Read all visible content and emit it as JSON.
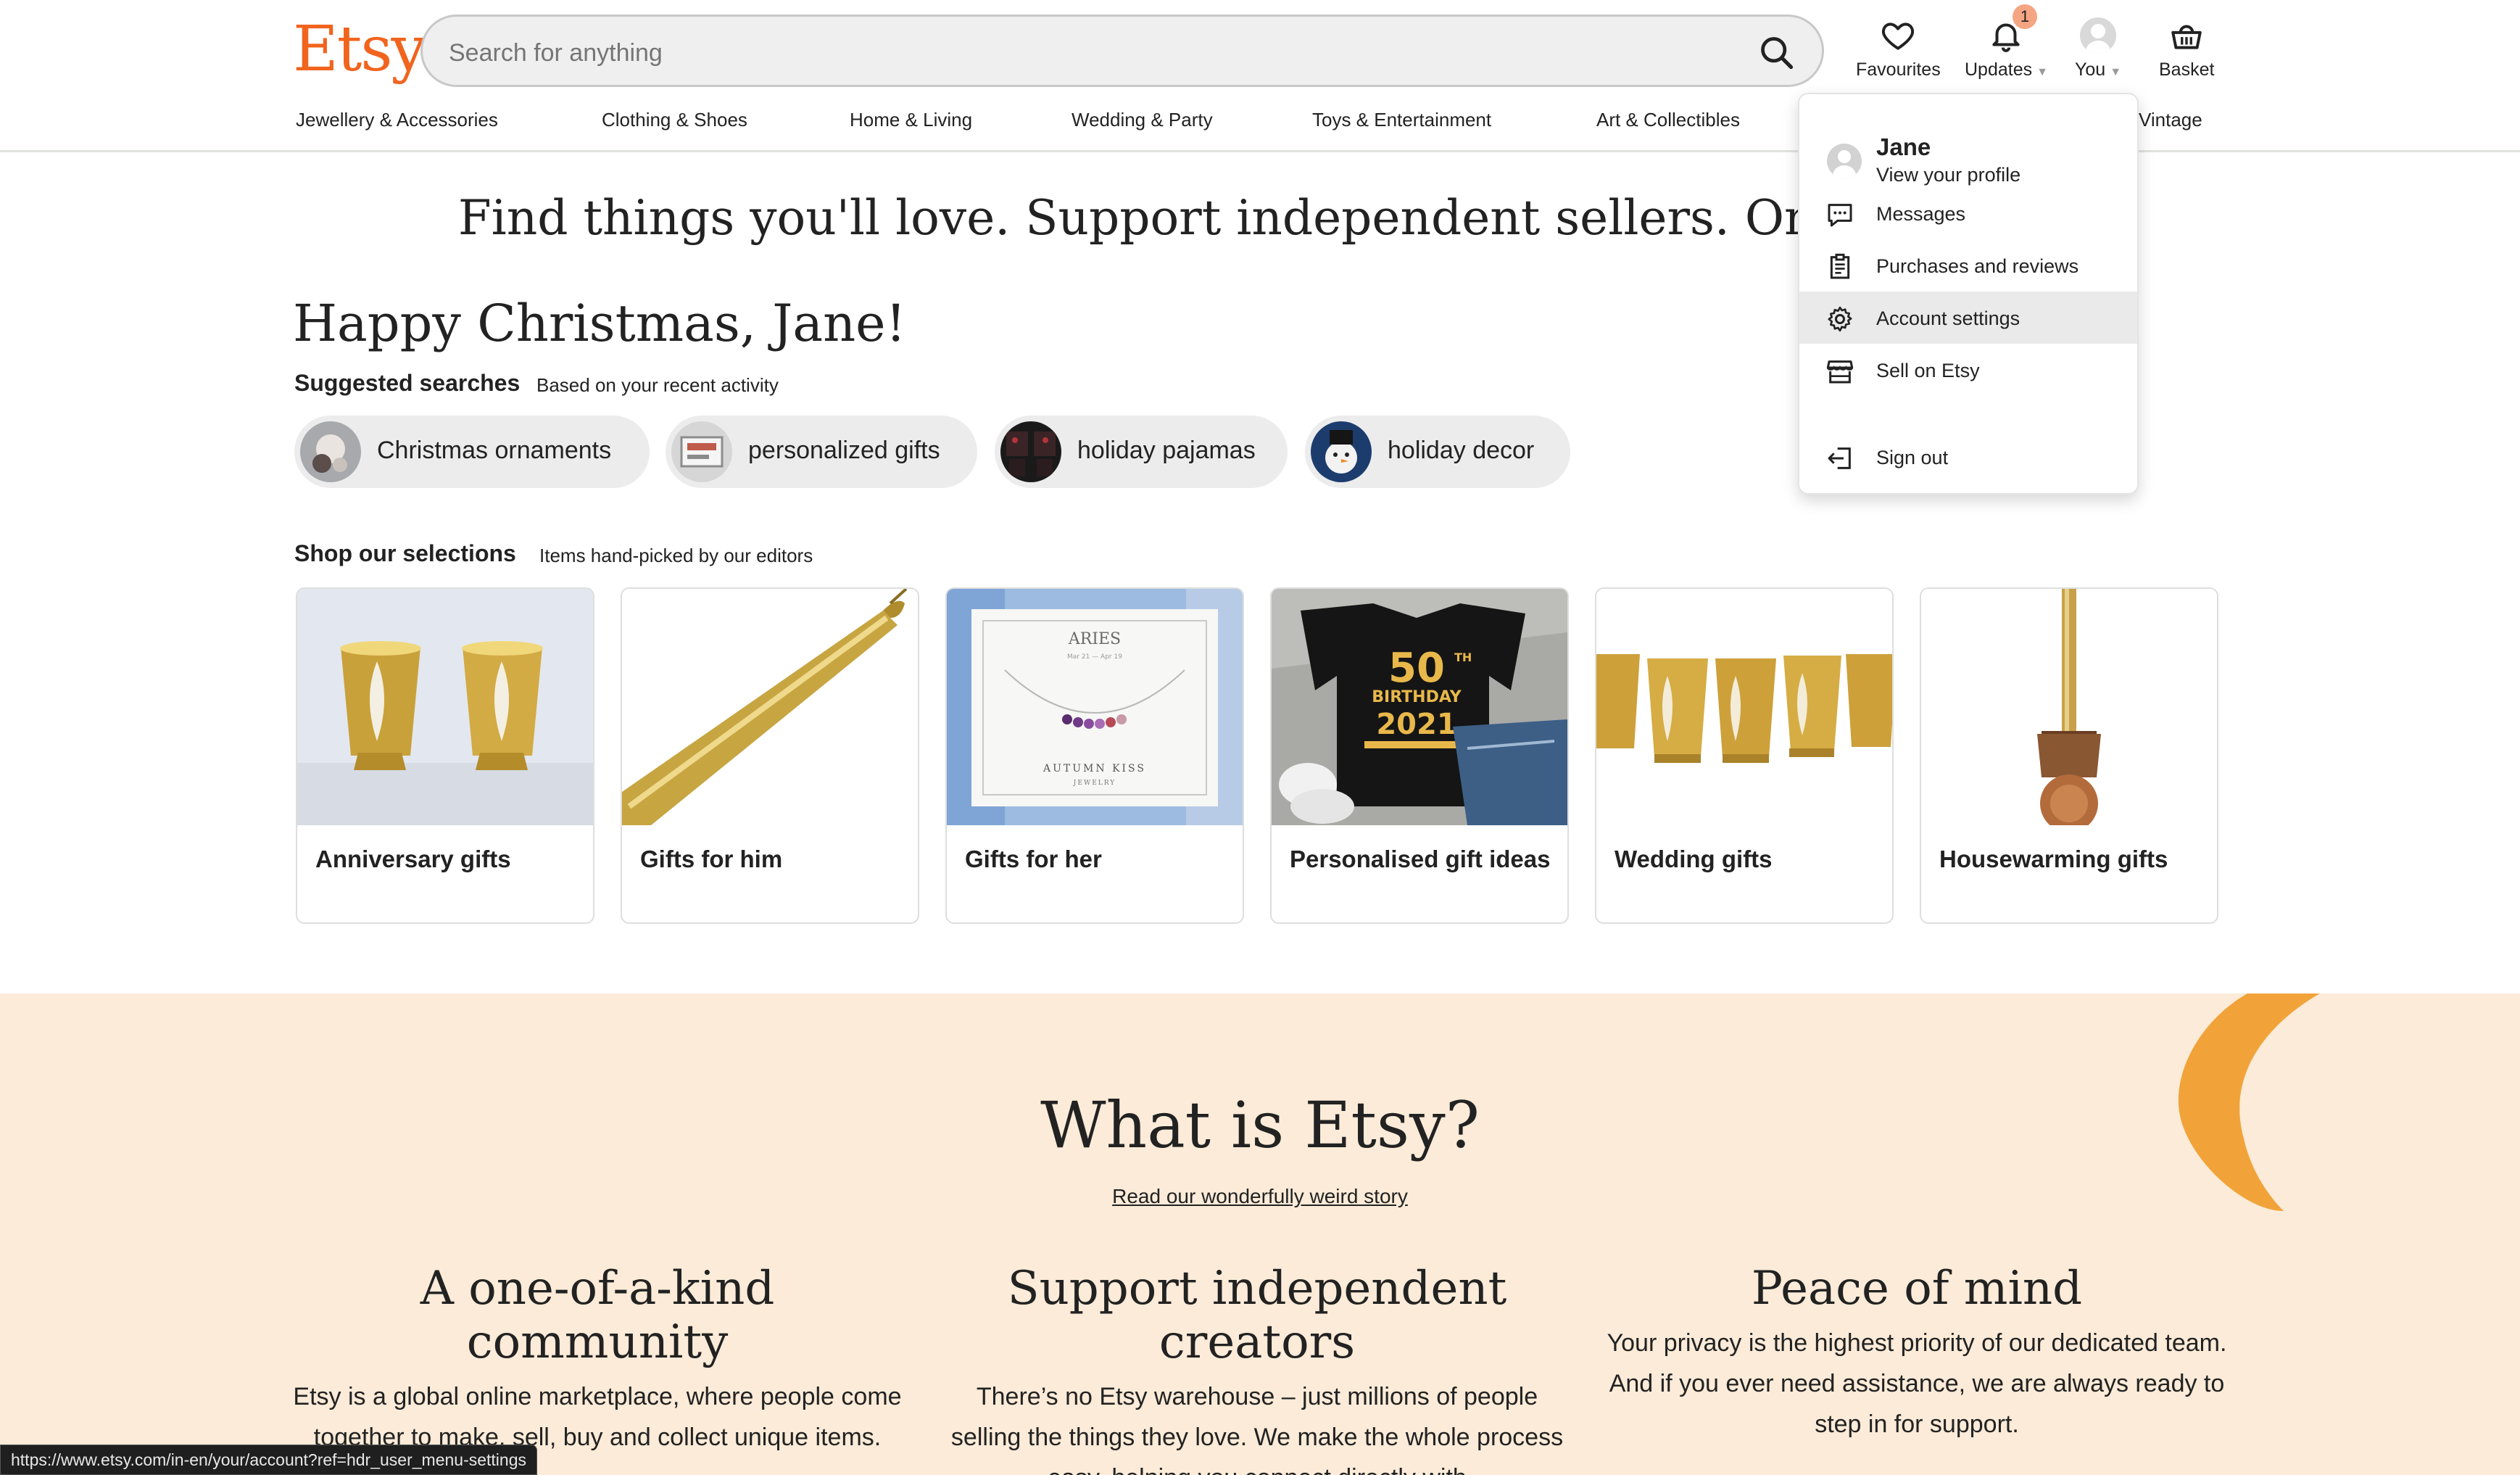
{
  "header": {
    "logo": "Etsy",
    "search_placeholder": "Search for anything",
    "actions": {
      "favourites": "Favourites",
      "updates": "Updates",
      "updates_badge": "1",
      "you": "You",
      "basket": "Basket"
    },
    "categories": [
      "Jewellery & Accessories",
      "Clothing & Shoes",
      "Home & Living",
      "Wedding & Party",
      "Toys & Entertainment",
      "Art & Collectibles",
      "Vintage"
    ]
  },
  "main": {
    "tagline": "Find things you'll love. Support independent sellers. Only on Etsy.",
    "greeting": "Happy Christmas, Jane!",
    "suggested": {
      "title": "Suggested searches",
      "subtitle": "Based on your recent activity",
      "items": [
        "Christmas ornaments",
        "personalized gifts",
        "holiday pajamas",
        "holiday decor"
      ]
    },
    "selections": {
      "title": "Shop our selections",
      "subtitle": "Items hand-picked by our editors",
      "cards": [
        {
          "title": "Anniversary gifts"
        },
        {
          "title": "Gifts for him"
        },
        {
          "title": "Gifts for her",
          "img_text": [
            "ARIES",
            "Mar 21 — Apr 19",
            "AUTUMN KISS",
            "JEWELRY"
          ]
        },
        {
          "title": "Personalised gift ideas",
          "img_text": [
            "50",
            "TH",
            "BIRTHDAY",
            "2021"
          ]
        },
        {
          "title": "Wedding gifts"
        },
        {
          "title": "Housewarming gifts"
        }
      ]
    }
  },
  "about": {
    "title": "What is Etsy?",
    "link": "Read our wonderfully weird story",
    "columns": [
      {
        "heading": "A one-of-a-kind community",
        "body": "Etsy is a global online marketplace, where people come together to make, sell, buy and collect unique items."
      },
      {
        "heading": "Support independent creators",
        "body": "There’s no Etsy warehouse – just millions of people selling the things they love. We make the whole process easy, helping you connect directly with"
      },
      {
        "heading": "Peace of mind",
        "body": "Your privacy is the highest priority of our dedicated team. And if you ever need assistance, we are always ready to step in for support."
      }
    ]
  },
  "dropdown": {
    "name": "Jane",
    "profile_link": "View your profile",
    "items": [
      "Messages",
      "Purchases and reviews",
      "Account settings",
      "Sell on Etsy"
    ],
    "sign_out": "Sign out",
    "active_item": "Account settings"
  },
  "status_url": "https://www.etsy.com/in-en/your/account?ref=hdr_user_menu-settings",
  "colors": {
    "brand": "#f1641e",
    "about_bg": "#fbebd8",
    "accent_shape": "#f1a33a",
    "badge": "#f4a582"
  }
}
